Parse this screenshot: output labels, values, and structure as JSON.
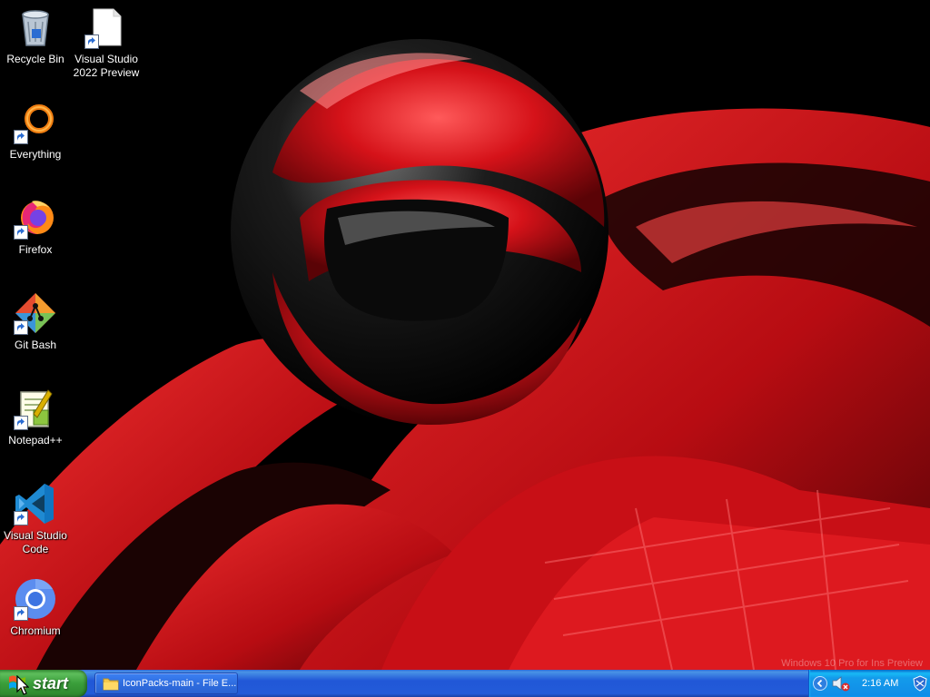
{
  "desktop": {
    "watermark": "Windows 10 Pro for Ins Preview",
    "icons": [
      {
        "label": "Recycle Bin",
        "icon": "recycle-bin-icon",
        "shortcut": false
      },
      {
        "label": "Visual Studio 2022 Preview",
        "icon": "document-icon",
        "shortcut": true
      },
      {
        "label": "Everything",
        "icon": "everything-icon",
        "shortcut": true
      },
      {
        "label": "Firefox",
        "icon": "firefox-icon",
        "shortcut": true
      },
      {
        "label": "Git Bash",
        "icon": "git-bash-icon",
        "shortcut": true
      },
      {
        "label": "Notepad++",
        "icon": "notepad-plus-plus-icon",
        "shortcut": true
      },
      {
        "label": "Visual Studio Code",
        "icon": "vscode-icon",
        "shortcut": true
      },
      {
        "label": "Chromium",
        "icon": "chromium-icon",
        "shortcut": true
      }
    ]
  },
  "taskbar": {
    "start_label": "start",
    "tasks": [
      {
        "label": "IconPacks-main - File E...",
        "icon": "folder-icon"
      }
    ],
    "tray": {
      "clock": "2:16 AM",
      "icons": [
        "show-hidden-icons-chevron-icon",
        "volume-muted-icon",
        "security-shield-icon"
      ]
    }
  },
  "colors": {
    "taskbar_blue": "#225bd8",
    "start_green": "#3a9e3a",
    "tray_blue": "#1290e8",
    "wallpaper_red": "#d0121b"
  }
}
